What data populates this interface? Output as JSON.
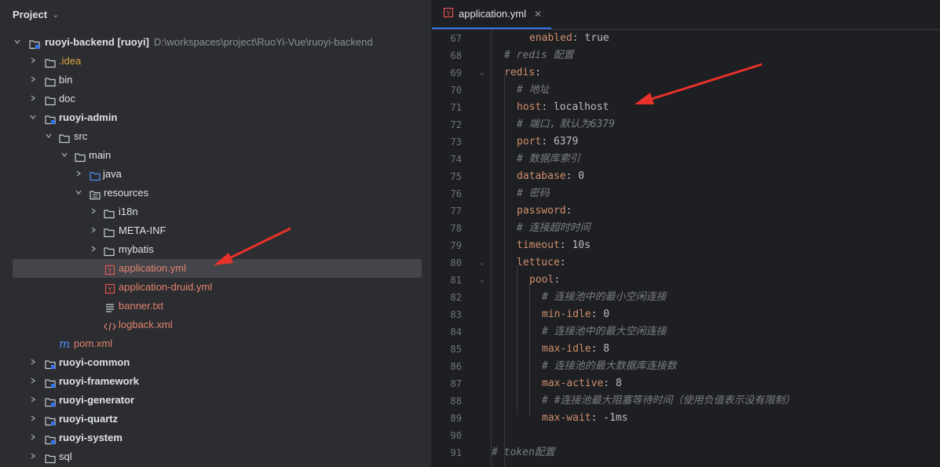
{
  "project_panel": {
    "title": "Project",
    "tree": [
      {
        "label": "ruoyi-backend [ruoyi]",
        "hint": "D:\\workspaces\\project\\RuoYi-Vue\\ruoyi-backend"
      },
      {
        "label": ".idea"
      },
      {
        "label": "bin"
      },
      {
        "label": "doc"
      },
      {
        "label": "ruoyi-admin"
      },
      {
        "label": "src"
      },
      {
        "label": "main"
      },
      {
        "label": "java"
      },
      {
        "label": "resources"
      },
      {
        "label": "i18n"
      },
      {
        "label": "META-INF"
      },
      {
        "label": "mybatis"
      },
      {
        "label": "application.yml"
      },
      {
        "label": "application-druid.yml"
      },
      {
        "label": "banner.txt"
      },
      {
        "label": "logback.xml"
      },
      {
        "label": "pom.xml"
      },
      {
        "label": "ruoyi-common"
      },
      {
        "label": "ruoyi-framework"
      },
      {
        "label": "ruoyi-generator"
      },
      {
        "label": "ruoyi-quartz"
      },
      {
        "label": "ruoyi-system"
      },
      {
        "label": "sql"
      }
    ]
  },
  "editor": {
    "tab_label": "application.yml",
    "lines": [
      {
        "num": "67",
        "key": "enabled",
        "value": "true"
      },
      {
        "num": "68",
        "comment": "# redis 配置"
      },
      {
        "num": "69",
        "key": "redis",
        "value": ""
      },
      {
        "num": "70",
        "comment": "# 地址"
      },
      {
        "num": "71",
        "key": "host",
        "value": "localhost"
      },
      {
        "num": "72",
        "comment": "# 端口，默认为6379"
      },
      {
        "num": "73",
        "key": "port",
        "value": "6379"
      },
      {
        "num": "74",
        "comment": "# 数据库索引"
      },
      {
        "num": "75",
        "key": "database",
        "value": "0"
      },
      {
        "num": "76",
        "comment": "# 密码"
      },
      {
        "num": "77",
        "key": "password",
        "value": ""
      },
      {
        "num": "78",
        "comment": "# 连接超时时间"
      },
      {
        "num": "79",
        "key": "timeout",
        "value": "10s"
      },
      {
        "num": "80",
        "key": "lettuce",
        "value": ""
      },
      {
        "num": "81",
        "key": "pool",
        "value": ""
      },
      {
        "num": "82",
        "comment": "# 连接池中的最小空闲连接"
      },
      {
        "num": "83",
        "key": "min-idle",
        "value": "0"
      },
      {
        "num": "84",
        "comment": "# 连接池中的最大空闲连接"
      },
      {
        "num": "85",
        "key": "max-idle",
        "value": "8"
      },
      {
        "num": "86",
        "comment": "# 连接池的最大数据库连接数"
      },
      {
        "num": "87",
        "key": "max-active",
        "value": "8"
      },
      {
        "num": "88",
        "comment": "# #连接池最大阻塞等待时间（使用负值表示没有限制）"
      },
      {
        "num": "89",
        "key": "max-wait",
        "value": "-1ms"
      },
      {
        "num": "90"
      },
      {
        "num": "91",
        "comment": "# token配置"
      }
    ]
  },
  "colors": {
    "annotation_arrow": "#e8312a",
    "tab_underline": "#3574f0",
    "selection": "#43454a"
  }
}
